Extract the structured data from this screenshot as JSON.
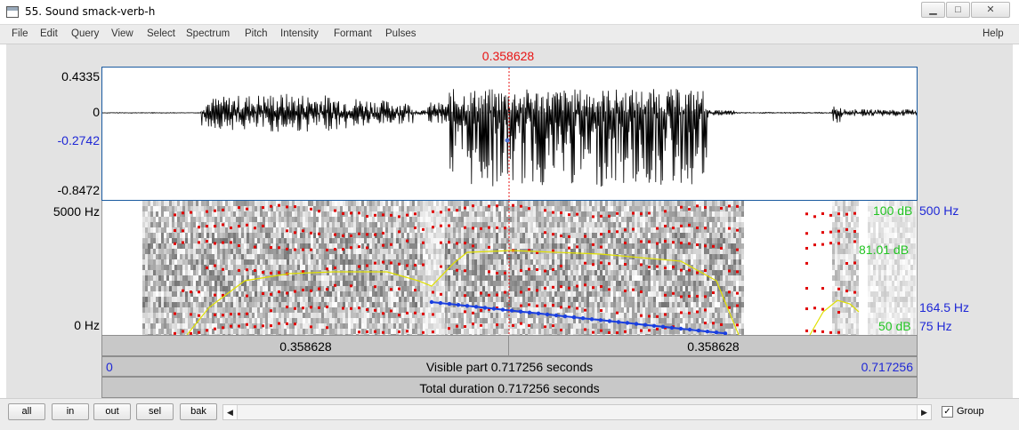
{
  "window": {
    "title": "55. Sound smack-verb-h",
    "minimize_glyph": "▁",
    "maximize_glyph": "□",
    "close_glyph": "✕"
  },
  "menubar": {
    "items": [
      "File",
      "Edit",
      "Query",
      "View",
      "Select",
      "Spectrum",
      "Pitch",
      "Intensity",
      "Formant",
      "Pulses"
    ],
    "help": "Help"
  },
  "editor": {
    "cursor_time_label": "0.358628",
    "waveform": {
      "amp_max": "0.4335",
      "amp_zero": "0",
      "amp_cursor": "-0.2742",
      "amp_min": "-0.8472"
    },
    "spectrogram": {
      "freq_top": "5000 Hz",
      "freq_bottom": "0 Hz",
      "intensity_max": "100 dB",
      "formant_max": "500 Hz",
      "intensity_at_cursor": "81.01 dB",
      "pitch_at_cursor": "164.5 Hz",
      "intensity_min": "50 dB",
      "pitch_min": "75 Hz"
    },
    "selection_bar": {
      "left": "0.358628",
      "right": "0.358628"
    },
    "visible_bar": {
      "start": "0",
      "text": "Visible part 0.717256 seconds",
      "end": "0.717256"
    },
    "total_bar": {
      "text": "Total duration 0.717256 seconds"
    }
  },
  "toolbar": {
    "all_label": "all",
    "in_label": "in",
    "out_label": "out",
    "sel_label": "sel",
    "bak_label": "bak",
    "scroll_left_icon": "◀",
    "scroll_right_icon": "▶",
    "group_checked": true,
    "group_label": "Group"
  },
  "colors": {
    "cursor": "#e81414",
    "formant_dots": "#e00000",
    "pitch_line": "#1a3fe0",
    "intensity_line": "#e0e000",
    "axis_blue": "#1f28d6",
    "intensity_text": "#22c422"
  }
}
